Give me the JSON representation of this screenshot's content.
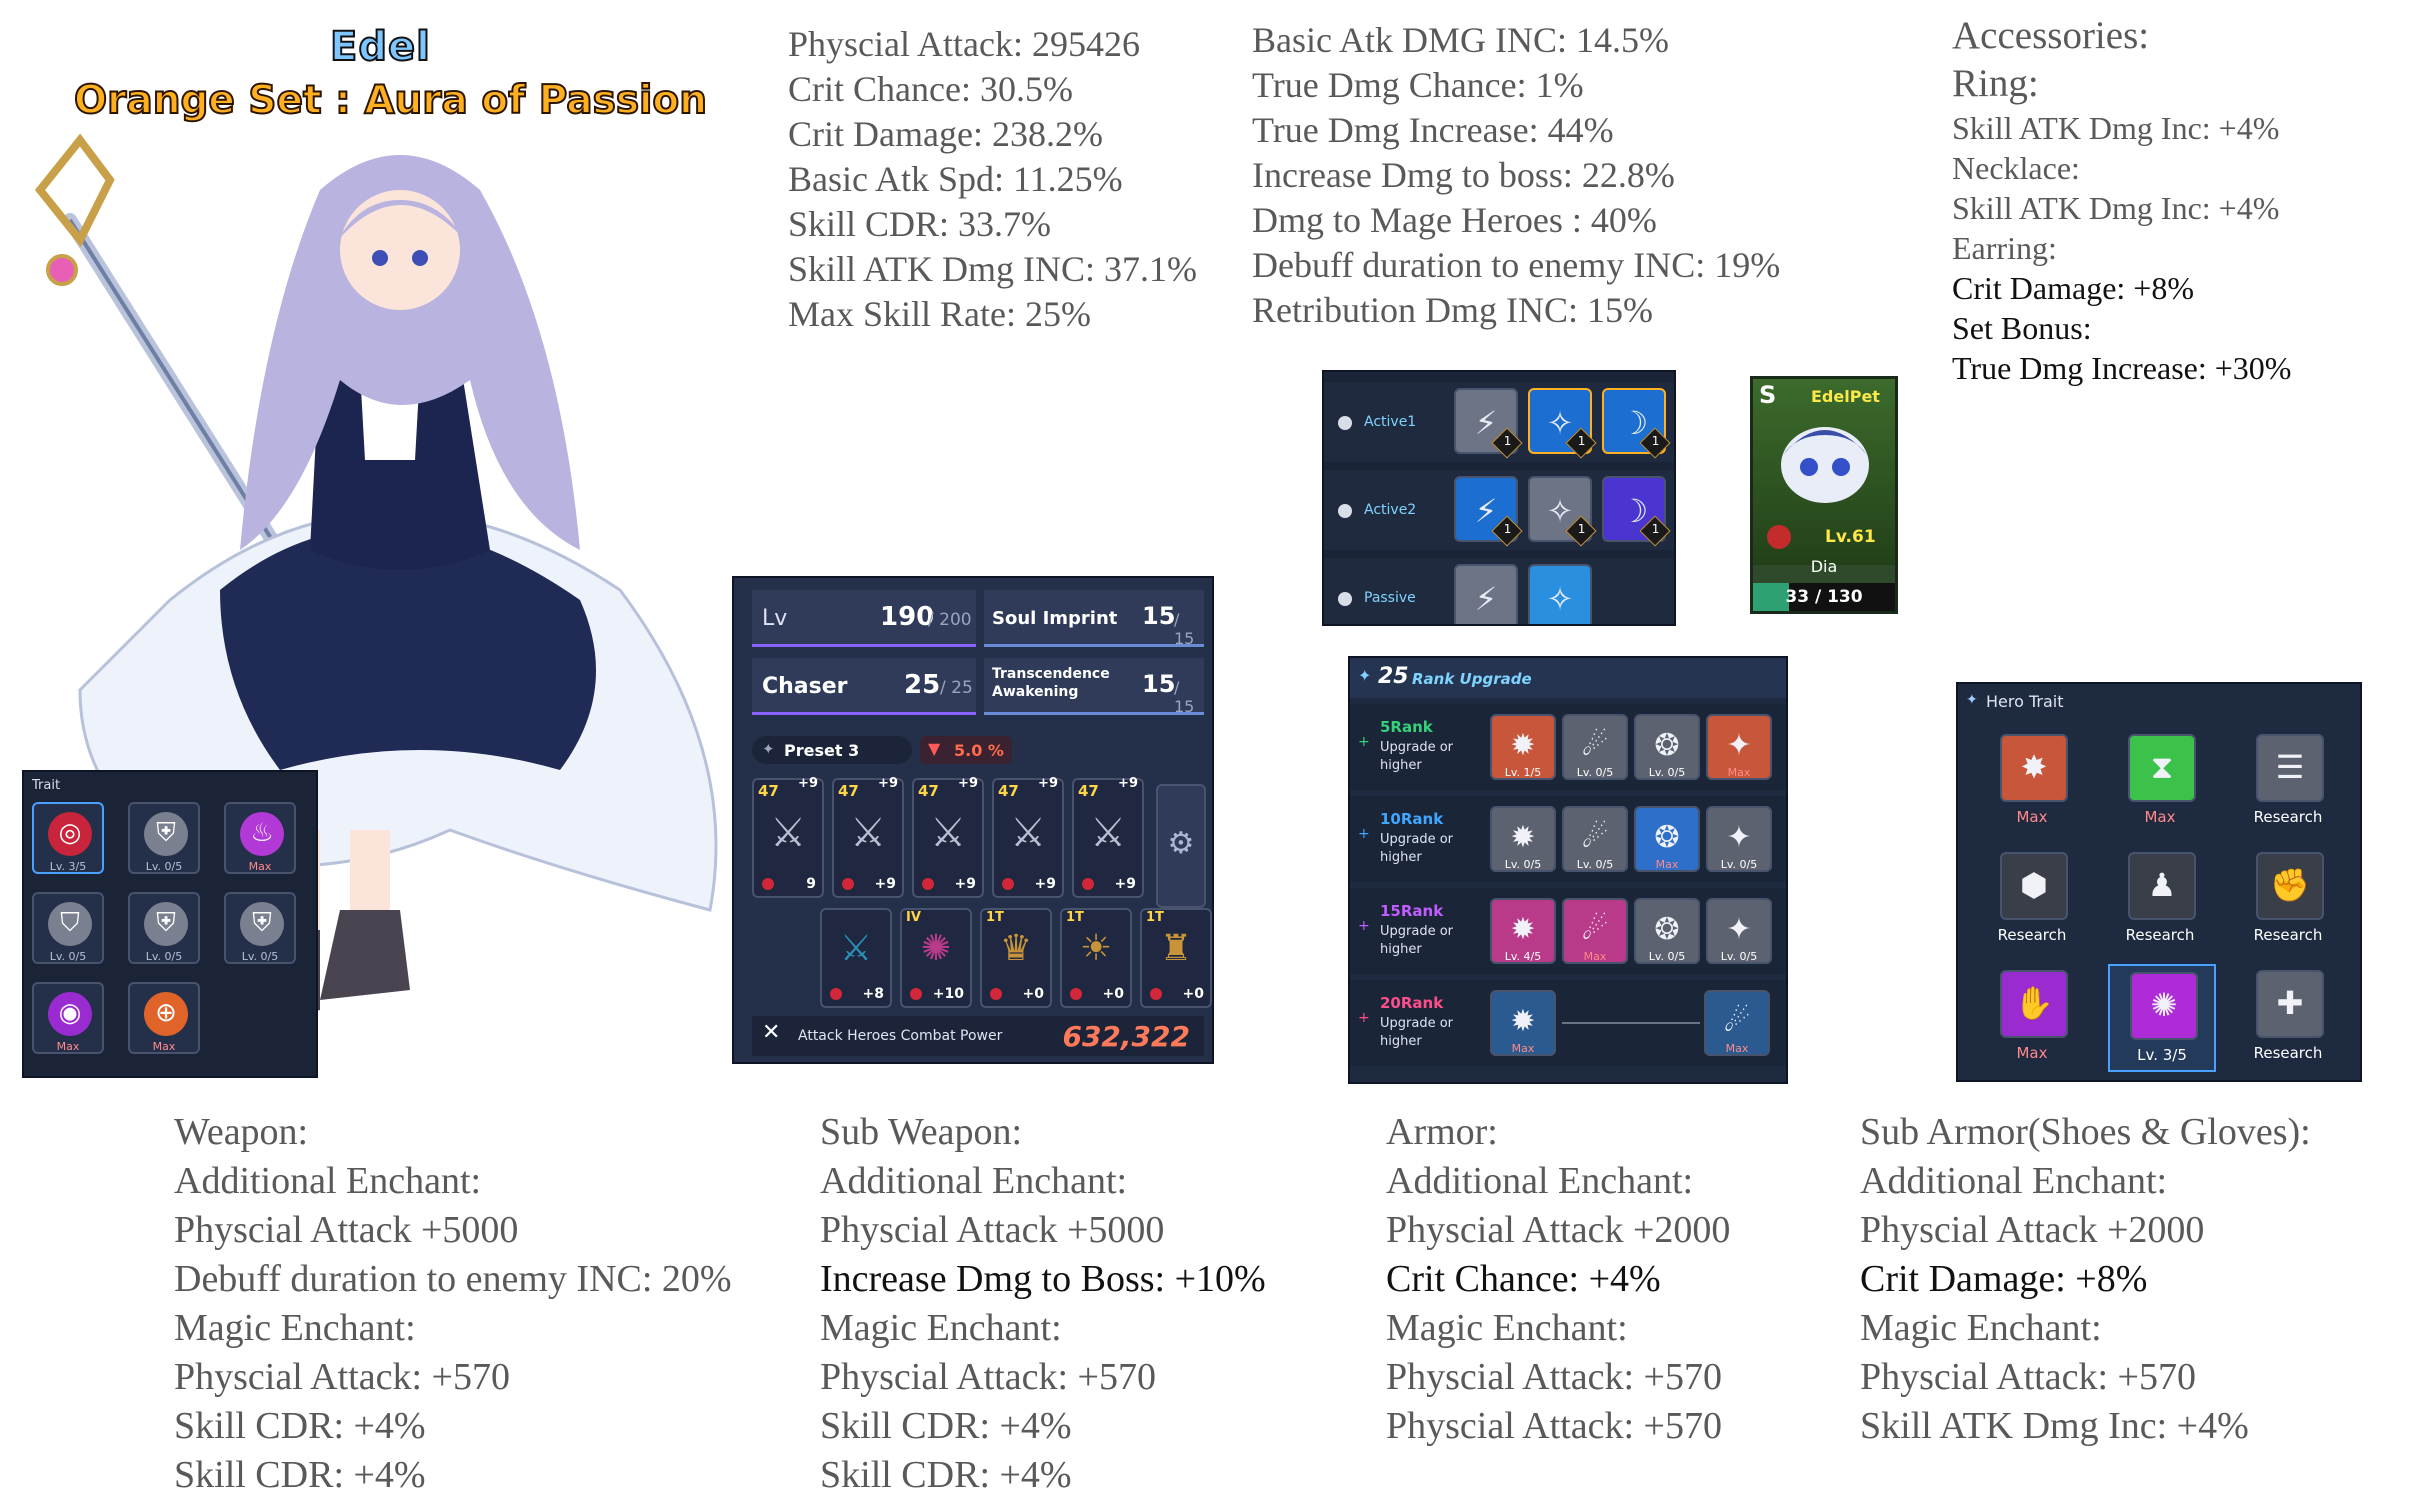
{
  "hero": {
    "name": "Edel",
    "set": "Orange Set : Aura of Passion"
  },
  "stats_col1": [
    "Physcial Attack: 295426",
    "Crit Chance: 30.5%",
    "Crit Damage: 238.2%",
    "Basic Atk Spd: 11.25%",
    "Skill CDR: 33.7%",
    "Skill ATK Dmg INC: 37.1%",
    "Max Skill Rate: 25%"
  ],
  "stats_col2": [
    "Basic Atk DMG INC: 14.5%",
    "True Dmg Chance: 1%",
    "True Dmg Increase: 44%",
    "Increase Dmg to boss: 22.8%",
    "Dmg to Mage Heroes : 40%",
    "Debuff duration to enemy INC: 19%",
    "Retribution Dmg INC: 15%"
  ],
  "accessories": {
    "heading": "Accessories:",
    "ring": "Ring:",
    "ring_val": "Skill ATK Dmg Inc: +4%",
    "necklace": "Necklace:",
    "necklace_val": "Skill ATK Dmg Inc: +4%",
    "earring": "Earring:",
    "earring_val": "Crit Damage: +8%",
    "set_bonus": "Set Bonus:",
    "set_bonus_val": "True Dmg Increase: +30%"
  },
  "trait_panel": {
    "title": "Trait",
    "slots": [
      "Lv. 3/5",
      "Lv. 0/5",
      "Max",
      "Lv. 0/5",
      "Lv. 0/5",
      "Lv. 0/5",
      "Max",
      "Max"
    ],
    "icons": [
      "target-icon",
      "shield-icon",
      "flame-icon",
      "wing-shield-icon",
      "pvp-shield-icon",
      "pvp-icon",
      "vortex-icon",
      "crosshair-icon"
    ]
  },
  "hero_panel": {
    "lv_label": "Lv",
    "lv": "190",
    "lv_max": "/ 200",
    "soul_label": "Soul Imprint",
    "soul": "15",
    "soul_max": "/ 15",
    "chaser_label": "Chaser",
    "chaser": "25",
    "chaser_max": "/ 25",
    "trans_label1": "Transcendence",
    "trans_label2": "Awakening",
    "trans": "15",
    "trans_max": "/ 15",
    "preset": "Preset 3",
    "bonus": "5.0 %",
    "gear_top": [
      {
        "lv": "47",
        "up": "+9",
        "bottom": "9"
      },
      {
        "lv": "47",
        "up": "+9",
        "bottom": "+9"
      },
      {
        "lv": "47",
        "up": "+9",
        "bottom": "+9"
      },
      {
        "lv": "47",
        "up": "+9",
        "bottom": "+9"
      },
      {
        "lv": "47",
        "up": "+9",
        "bottom": "+9"
      }
    ],
    "gear_bottom": [
      {
        "tag": "",
        "bottom": "+8"
      },
      {
        "tag": "IV",
        "bottom": "+10"
      },
      {
        "tag": "1T",
        "bottom": "+0"
      },
      {
        "tag": "1T",
        "bottom": "+0"
      },
      {
        "tag": "1T",
        "bottom": "+0"
      }
    ],
    "cp_label": "Attack Heroes Combat Power",
    "cp": "632,322"
  },
  "skill_panel": {
    "rows": [
      {
        "label": "Active1",
        "count": 3
      },
      {
        "label": "Active2",
        "count": 3
      },
      {
        "label": "Passive",
        "count": 2
      }
    ],
    "badge": "1"
  },
  "pet_panel": {
    "grade": "S",
    "name": "EdelPet",
    "level": "Lv.61",
    "currency": "Dia",
    "progress": "33 / 130",
    "fill": 0.254
  },
  "rank_panel": {
    "count": "25",
    "title": "Rank Upgrade",
    "rows": [
      {
        "rank": "5Rank",
        "desc1": "Upgrade or",
        "desc2": "higher",
        "slots": [
          "Lv. 1/5",
          "Lv. 0/5",
          "Lv. 0/5",
          "Max"
        ],
        "color": "#33d17a"
      },
      {
        "rank": "10Rank",
        "desc1": "Upgrade or",
        "desc2": "higher",
        "slots": [
          "Lv. 0/5",
          "Lv. 0/5",
          "Max",
          "Lv. 0/5"
        ],
        "color": "#3fa7ff"
      },
      {
        "rank": "15Rank",
        "desc1": "Upgrade or",
        "desc2": "higher",
        "slots": [
          "Lv. 4/5",
          "Max",
          "Lv. 0/5",
          "Lv. 0/5"
        ],
        "color": "#c15cff"
      },
      {
        "rank": "20Rank",
        "desc1": "Upgrade or",
        "desc2": "higher",
        "slots": [
          "Max",
          "Max"
        ],
        "color": "#ff4f8b"
      }
    ]
  },
  "hero_trait": {
    "title": "Hero Trait",
    "slots": [
      "Max",
      "Max",
      "Research",
      "Research",
      "Research",
      "Research",
      "Max",
      "Lv. 3/5",
      "Research"
    ]
  },
  "weapon": [
    "Weapon:",
    "Additional Enchant:",
    "Physcial Attack +5000",
    "Debuff duration to enemy INC: 20%",
    "Magic Enchant:",
    "Physcial Attack: +570",
    "Skill CDR: +4%",
    "Skill CDR: +4%"
  ],
  "sub_weapon": [
    "Sub Weapon:",
    "Additional Enchant:",
    "Physcial Attack +5000",
    "Increase Dmg to Boss: +10%",
    "Magic Enchant:",
    "Physcial Attack: +570",
    "Skill CDR: +4%",
    "Skill CDR: +4%"
  ],
  "armor": [
    "Armor:",
    "Additional Enchant:",
    "Physcial Attack +2000",
    "Crit Chance: +4%",
    "Magic Enchant:",
    "Physcial Attack: +570",
    "Physcial Attack: +570"
  ],
  "sub_armor": [
    "Sub Armor(Shoes & Gloves):",
    "Additional Enchant:",
    "Physcial Attack +2000",
    "Crit Damage: +8%",
    "Magic Enchant:",
    "Physcial Attack: +570",
    "Skill ATK Dmg Inc: +4%"
  ]
}
